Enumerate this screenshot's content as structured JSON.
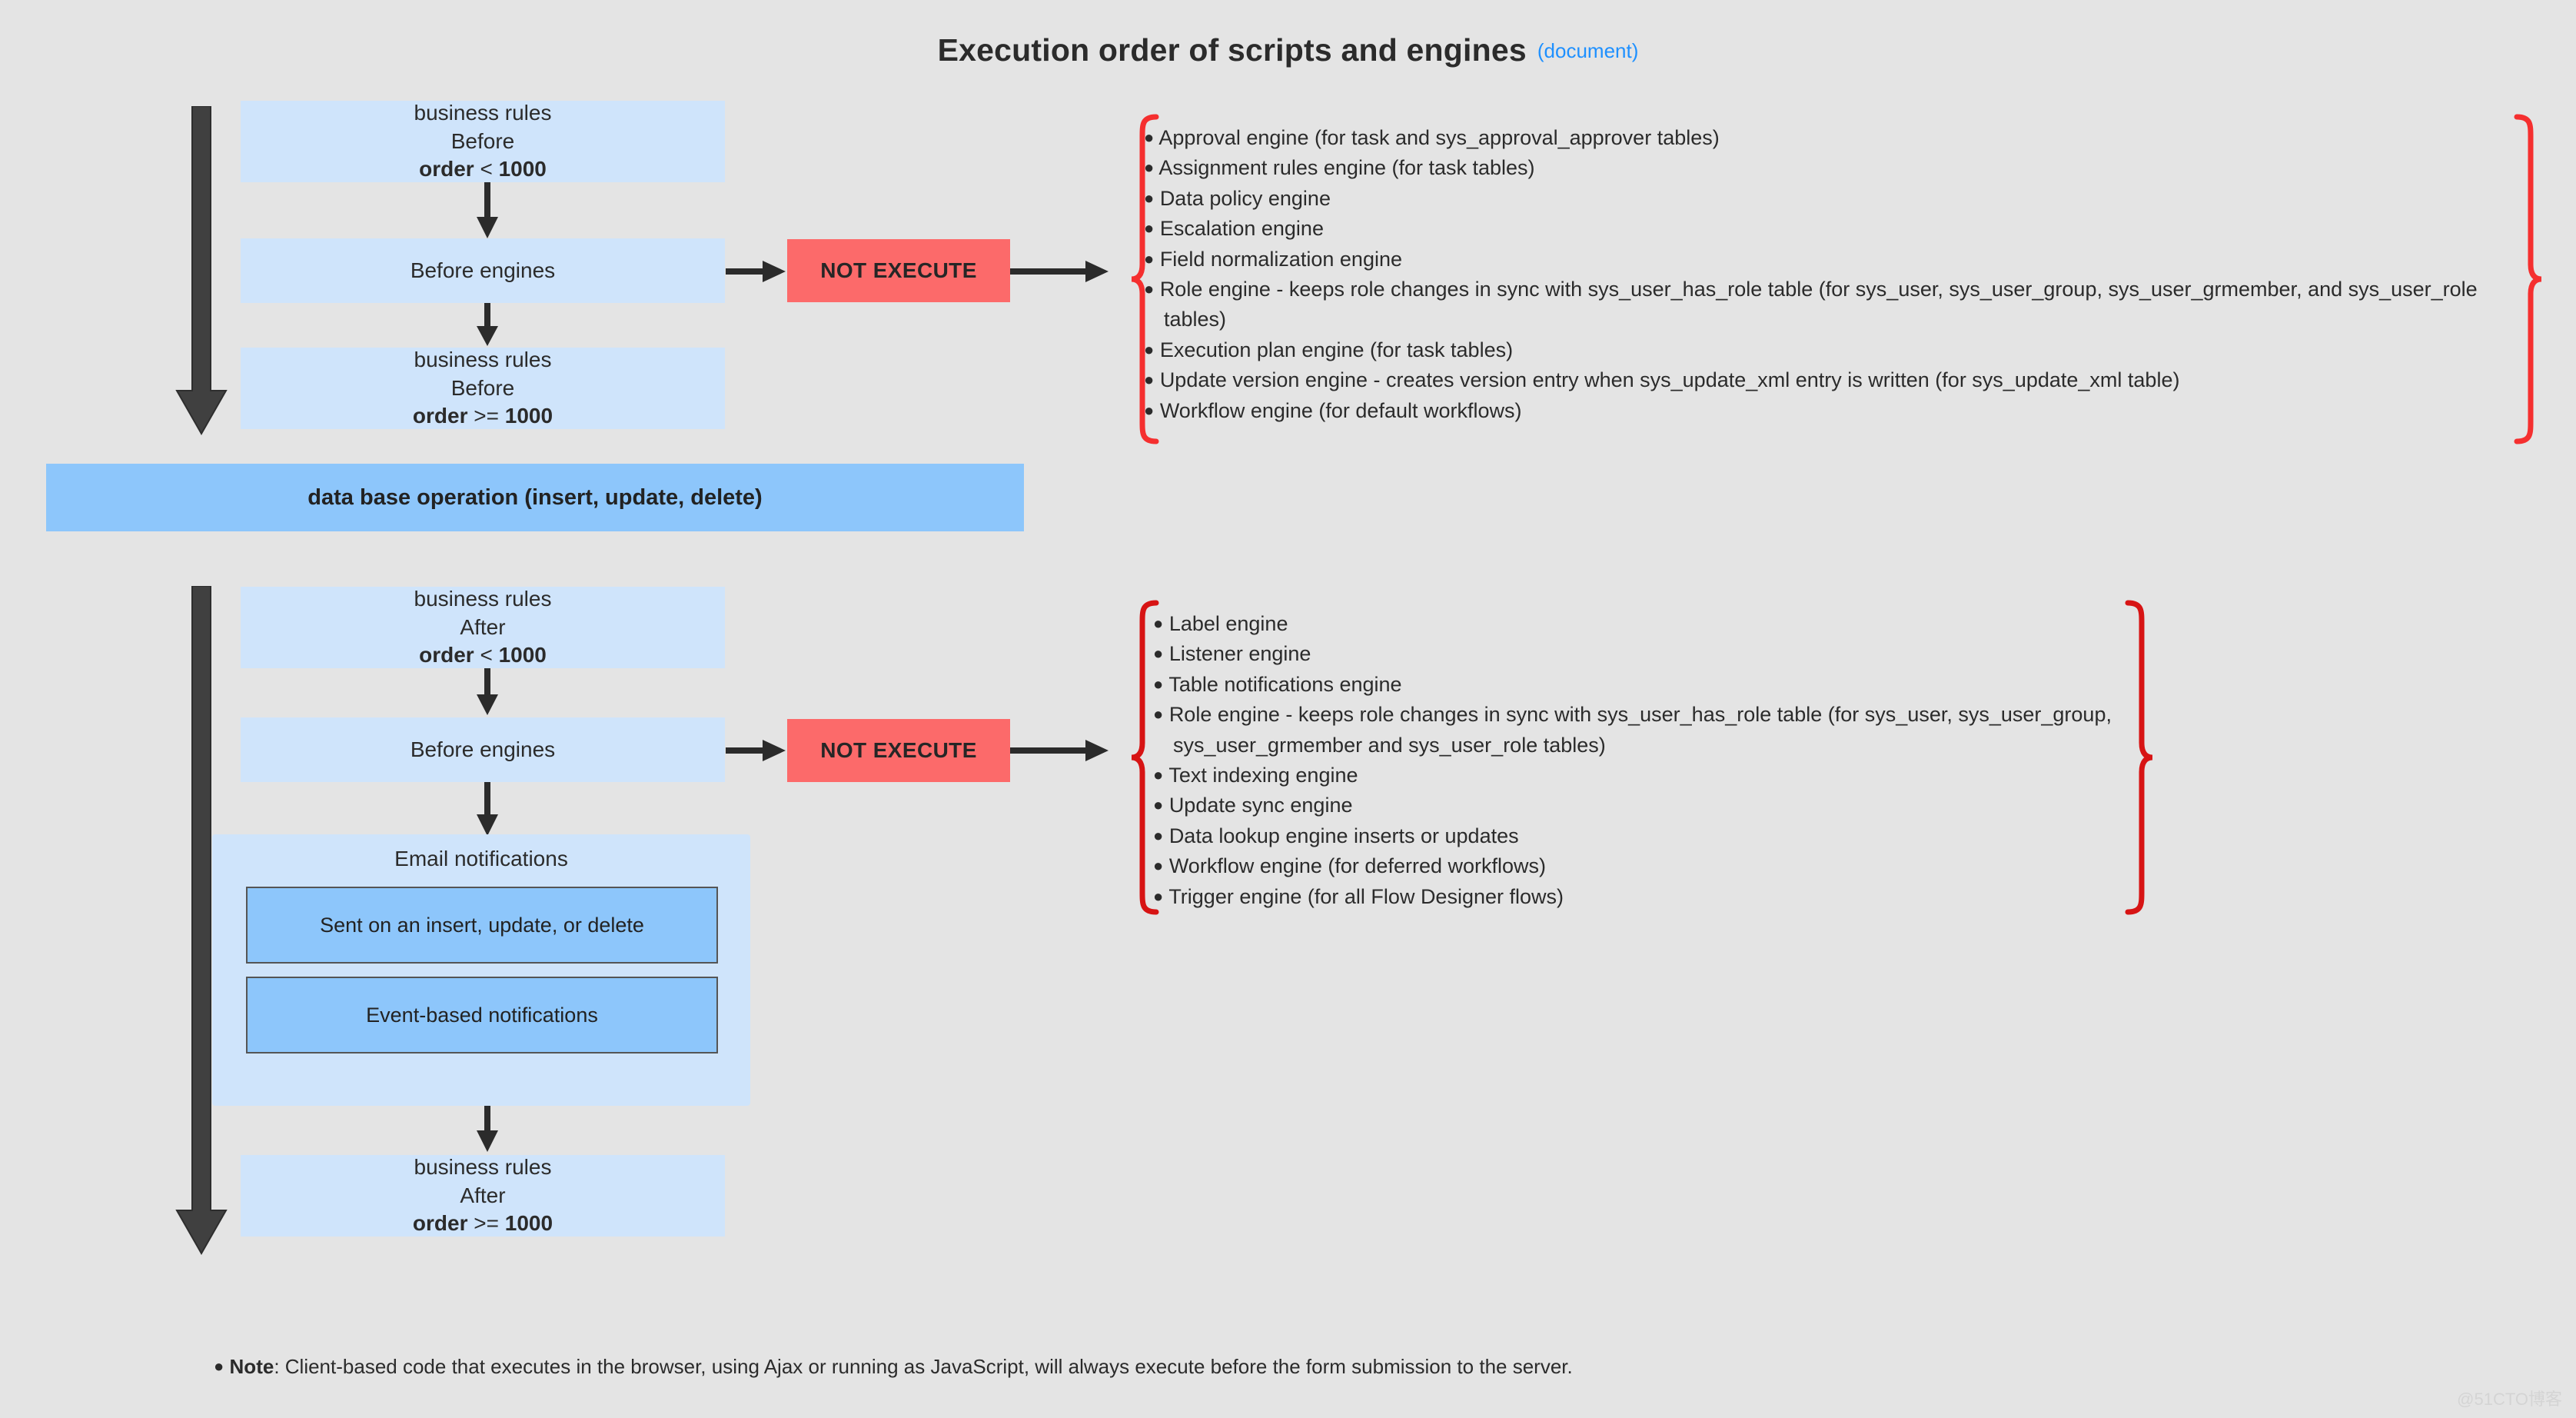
{
  "header": {
    "title": "Execution order of scripts and engines",
    "doc_tag": "(document)"
  },
  "colors": {
    "background": "#e4e4e4",
    "box_fill": "#cfe4fb",
    "db_bar_fill": "#8dc6fb",
    "not_execute_fill": "#fc6a6a",
    "brace_red": "#f52f2f",
    "brace_red_dark": "#d71414",
    "arrow_dark": "#404040",
    "doc_link": "#1e90ff"
  },
  "flow": {
    "before": [
      {
        "name": "business-rules-before-lt-1000",
        "line1": "business rules",
        "line2": "Before",
        "order_label": "order",
        "order_cmp": "<",
        "order_value": "1000"
      },
      {
        "name": "before-engines-top",
        "line1": "Before engines"
      },
      {
        "name": "business-rules-before-gte-1000",
        "line1": "business rules",
        "line2": "Before",
        "order_label": "order",
        "order_cmp": ">=",
        "order_value": "1000"
      }
    ],
    "db_operation": "data base operation (insert, update, delete)",
    "after": [
      {
        "name": "business-rules-after-lt-1000",
        "line1": "business rules",
        "line2": "After",
        "order_label": "order",
        "order_cmp": "<",
        "order_value": "1000"
      },
      {
        "name": "before-engines-bottom",
        "line1": "Before engines"
      },
      {
        "name": "business-rules-after-gte-1000",
        "line1": "business rules",
        "line2": "After",
        "order_label": "order",
        "order_cmp": ">=",
        "order_value": "1000"
      }
    ],
    "email_notifications": {
      "title": "Email notifications",
      "items": [
        "Sent on an insert, update, or delete",
        "Event-based notifications"
      ]
    }
  },
  "not_execute": {
    "top_label": "NOT EXECUTE",
    "bottom_label": "NOT EXECUTE"
  },
  "engines_top": {
    "items": [
      "Approval engine (for task and sys_approval_approver tables)",
      "Assignment rules engine (for task tables)",
      "Data policy engine",
      "Escalation engine",
      "Field normalization engine",
      "Role engine - keeps role changes in sync with sys_user_has_role table (for sys_user, sys_user_group, sys_user_grmember, and sys_user_role tables)",
      "Execution plan engine (for task tables)",
      "Update version engine - creates version entry when sys_update_xml entry is written (for sys_update_xml table)",
      "Workflow engine (for default workflows)"
    ]
  },
  "engines_bottom": {
    "items": [
      "Label engine",
      "Listener engine",
      "Table notifications engine",
      "Role engine - keeps role changes in sync with sys_user_has_role table (for sys_user, sys_user_group,  sys_user_grmember and sys_user_role tables)",
      "Text indexing engine",
      "Update sync engine",
      "Data lookup engine inserts or updates",
      "Workflow engine (for deferred workflows)",
      "Trigger engine (for all Flow Designer flows)"
    ]
  },
  "note": {
    "bullet": "●",
    "label": "Note",
    "separator": ": ",
    "text": "Client-based code that executes in the browser, using Ajax or running as JavaScript, will always execute before the form submission to the server."
  },
  "watermark": "@51CTO博客"
}
